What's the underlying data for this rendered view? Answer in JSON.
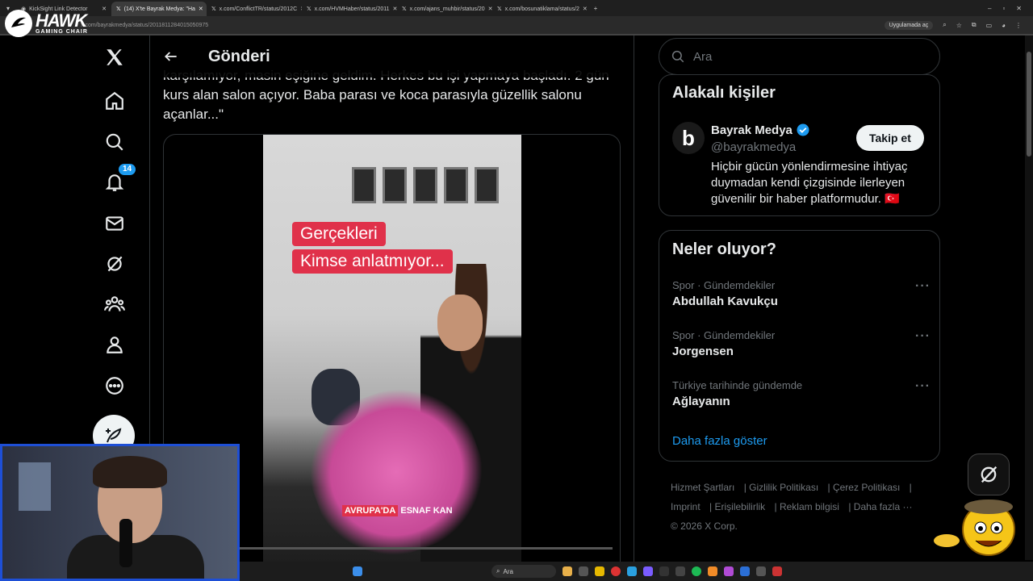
{
  "browser": {
    "tabs": [
      {
        "label": "KickSight Link Detector",
        "active": false
      },
      {
        "label": "(14) X'te Bayrak Medya: \"Ha",
        "active": true
      },
      {
        "label": "x.com/ConflictTR/status/2012C",
        "active": false
      },
      {
        "label": "x.com/HVMHaber/status/2011",
        "active": false
      },
      {
        "label": "x.com/ajans_muhbir/status/20",
        "active": false
      },
      {
        "label": "x.com/bosunatiklama/status/2",
        "active": false
      }
    ],
    "url": "x.com/bayrakmedya/status/2011811284015050975",
    "app_pill": "Uygulamada aç"
  },
  "overlay": {
    "brand": "HAWK",
    "brand_sub": "GAMING CHAIR"
  },
  "nav": {
    "notifications_badge": "14"
  },
  "header": {
    "title": "Gönderi"
  },
  "post": {
    "text": "karşılamıyor, masin eşiğine geldim. Herkes bu işi yapmaya başladı. 2 gün kurs alan salon açıyor. Baba parası ve koca parasıyla güzellik salonu açanlar...\"",
    "video": {
      "caption_line1": "Gerçekleri",
      "caption_line2": "Kimse anlatmıyor...",
      "subtitle_highlight": "AVRUPA'DA",
      "subtitle_rest": " ESNAF KAN"
    }
  },
  "search": {
    "placeholder": "Ara"
  },
  "related": {
    "title": "Alakalı kişiler",
    "name": "Bayrak Medya",
    "handle": "@bayrakmedya",
    "follow_label": "Takip et",
    "bio": "Hiçbir gücün yönlendirmesine ihtiyaç duymadan kendi çizgisinde ilerleyen güvenilir bir haber platformudur. 🇹🇷"
  },
  "trends": {
    "title": "Neler oluyor?",
    "items": [
      {
        "meta": "Spor · Gündemdekiler",
        "name": "Abdullah Kavukçu"
      },
      {
        "meta": "Spor · Gündemdekiler",
        "name": "Jorgensen"
      },
      {
        "meta": "Türkiye tarihinde gündemde",
        "name": "Ağlayanın"
      }
    ],
    "show_more": "Daha fazla göster"
  },
  "footer": {
    "links": [
      "Hizmet Şartları",
      "Gizlilik Politikası",
      "Çerez Politikası",
      "Imprint",
      "Erişilebilirlik",
      "Reklam bilgisi",
      "Daha fazla ···"
    ],
    "copyright": "© 2026 X Corp."
  },
  "taskbar": {
    "search_placeholder": "Ara"
  },
  "colors": {
    "accent": "#1d9bf0",
    "background": "#000000",
    "border": "#2f3336",
    "caption_red": "#e0314a"
  }
}
